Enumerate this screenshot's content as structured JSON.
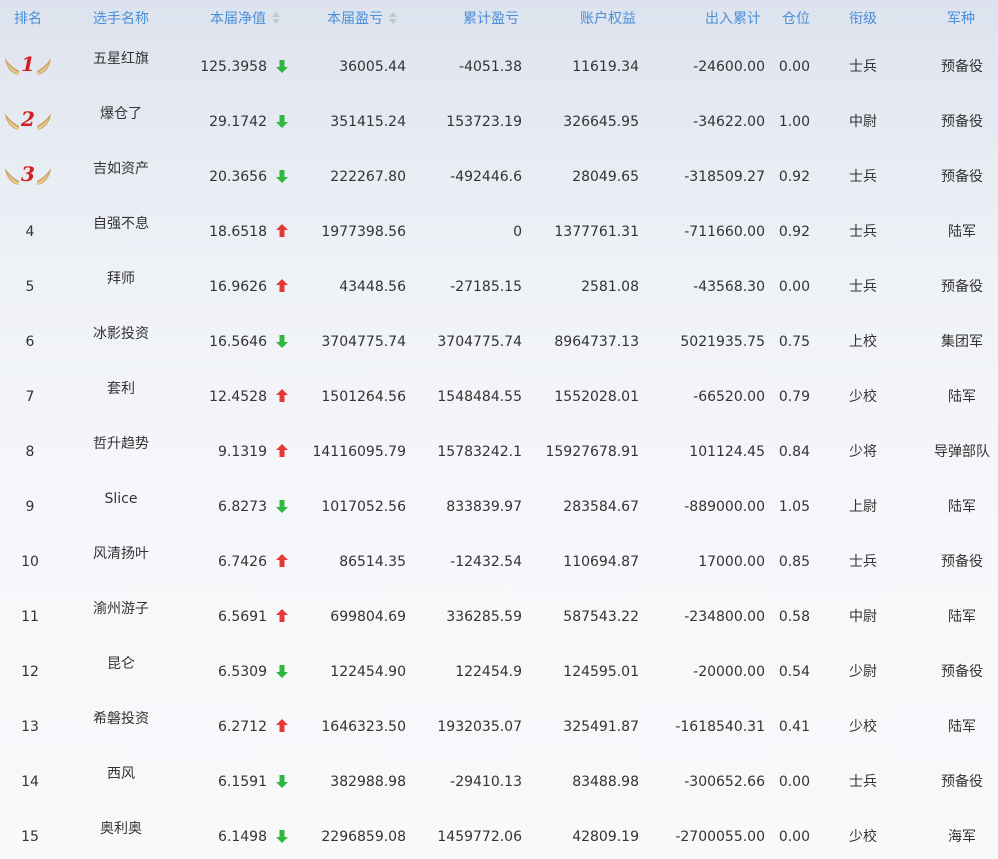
{
  "colors": {
    "header_text": "#4a8fd8",
    "body_text": "#333333",
    "arrow_up": "#e53935",
    "arrow_down": "#2fb83d",
    "medal_number": "#d41f1f",
    "wing_gold": "#c9a25e"
  },
  "table": {
    "headers": {
      "rank": "排名",
      "name": "选手名称",
      "nav": "本届净值",
      "pnl": "本届盈亏",
      "cumulative": "累计盈亏",
      "equity": "账户权益",
      "flow": "出入累计",
      "position": "仓位",
      "rank_title": "衔级",
      "branch": "军种"
    },
    "rows": [
      {
        "rank": "1",
        "medal": true,
        "name": "五星红旗",
        "nav": "125.3958",
        "trend": "down",
        "pnl": "36005.44",
        "cumulative": "-4051.38",
        "equity": "11619.34",
        "flow": "-24600.00",
        "position": "0.00",
        "rank_title": "士兵",
        "branch": "预备役"
      },
      {
        "rank": "2",
        "medal": true,
        "name": "爆仓了",
        "nav": "29.1742",
        "trend": "down",
        "pnl": "351415.24",
        "cumulative": "153723.19",
        "equity": "326645.95",
        "flow": "-34622.00",
        "position": "1.00",
        "rank_title": "中尉",
        "branch": "预备役"
      },
      {
        "rank": "3",
        "medal": true,
        "name": "吉如资产",
        "nav": "20.3656",
        "trend": "down",
        "pnl": "222267.80",
        "cumulative": "-492446.6",
        "equity": "28049.65",
        "flow": "-318509.27",
        "position": "0.92",
        "rank_title": "士兵",
        "branch": "预备役"
      },
      {
        "rank": "4",
        "medal": false,
        "name": "自强不息",
        "nav": "18.6518",
        "trend": "up",
        "pnl": "1977398.56",
        "cumulative": "0",
        "equity": "1377761.31",
        "flow": "-711660.00",
        "position": "0.92",
        "rank_title": "士兵",
        "branch": "陆军"
      },
      {
        "rank": "5",
        "medal": false,
        "name": "拜师",
        "nav": "16.9626",
        "trend": "up",
        "pnl": "43448.56",
        "cumulative": "-27185.15",
        "equity": "2581.08",
        "flow": "-43568.30",
        "position": "0.00",
        "rank_title": "士兵",
        "branch": "预备役"
      },
      {
        "rank": "6",
        "medal": false,
        "name": "冰影投资",
        "nav": "16.5646",
        "trend": "down",
        "pnl": "3704775.74",
        "cumulative": "3704775.74",
        "equity": "8964737.13",
        "flow": "5021935.75",
        "position": "0.75",
        "rank_title": "上校",
        "branch": "集团军"
      },
      {
        "rank": "7",
        "medal": false,
        "name": "套利",
        "nav": "12.4528",
        "trend": "up",
        "pnl": "1501264.56",
        "cumulative": "1548484.55",
        "equity": "1552028.01",
        "flow": "-66520.00",
        "position": "0.79",
        "rank_title": "少校",
        "branch": "陆军"
      },
      {
        "rank": "8",
        "medal": false,
        "name": "哲升趋势",
        "nav": "9.1319",
        "trend": "up",
        "pnl": "14116095.79",
        "cumulative": "15783242.1",
        "equity": "15927678.91",
        "flow": "101124.45",
        "position": "0.84",
        "rank_title": "少将",
        "branch": "导弹部队"
      },
      {
        "rank": "9",
        "medal": false,
        "name": "Slice",
        "nav": "6.8273",
        "trend": "down",
        "pnl": "1017052.56",
        "cumulative": "833839.97",
        "equity": "283584.67",
        "flow": "-889000.00",
        "position": "1.05",
        "rank_title": "上尉",
        "branch": "陆军"
      },
      {
        "rank": "10",
        "medal": false,
        "name": "风清扬叶",
        "nav": "6.7426",
        "trend": "up",
        "pnl": "86514.35",
        "cumulative": "-12432.54",
        "equity": "110694.87",
        "flow": "17000.00",
        "position": "0.85",
        "rank_title": "士兵",
        "branch": "预备役"
      },
      {
        "rank": "11",
        "medal": false,
        "name": "渝州游子",
        "nav": "6.5691",
        "trend": "up",
        "pnl": "699804.69",
        "cumulative": "336285.59",
        "equity": "587543.22",
        "flow": "-234800.00",
        "position": "0.58",
        "rank_title": "中尉",
        "branch": "陆军"
      },
      {
        "rank": "12",
        "medal": false,
        "name": "昆仑",
        "nav": "6.5309",
        "trend": "down",
        "pnl": "122454.90",
        "cumulative": "122454.9",
        "equity": "124595.01",
        "flow": "-20000.00",
        "position": "0.54",
        "rank_title": "少尉",
        "branch": "预备役"
      },
      {
        "rank": "13",
        "medal": false,
        "name": "希磐投资",
        "nav": "6.2712",
        "trend": "up",
        "pnl": "1646323.50",
        "cumulative": "1932035.07",
        "equity": "325491.87",
        "flow": "-1618540.31",
        "position": "0.41",
        "rank_title": "少校",
        "branch": "陆军"
      },
      {
        "rank": "14",
        "medal": false,
        "name": "西风",
        "nav": "6.1591",
        "trend": "down",
        "pnl": "382988.98",
        "cumulative": "-29410.13",
        "equity": "83488.98",
        "flow": "-300652.66",
        "position": "0.00",
        "rank_title": "士兵",
        "branch": "预备役"
      },
      {
        "rank": "15",
        "medal": false,
        "name": "奥利奥",
        "nav": "6.1498",
        "trend": "down",
        "pnl": "2296859.08",
        "cumulative": "1459772.06",
        "equity": "42809.19",
        "flow": "-2700055.00",
        "position": "0.00",
        "rank_title": "少校",
        "branch": "海军"
      }
    ]
  }
}
